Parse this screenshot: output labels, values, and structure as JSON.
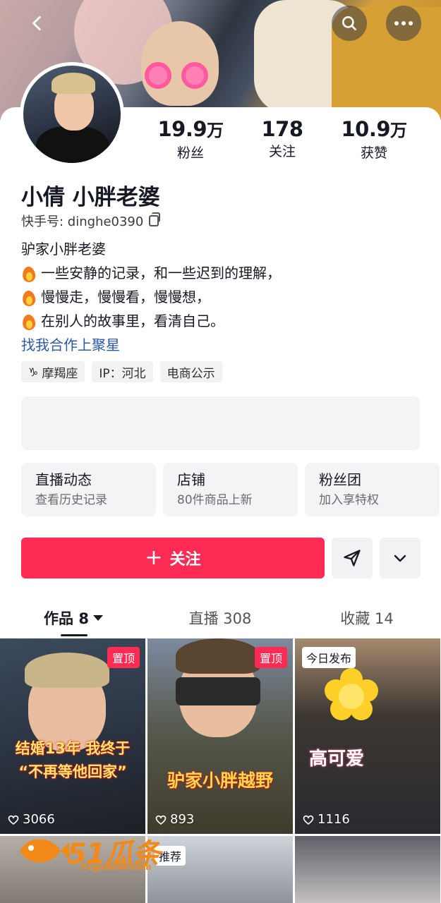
{
  "header": {
    "back_icon": "chevron-left-icon",
    "search_icon": "search-icon",
    "more_icon": "more-horizontal-icon"
  },
  "profile": {
    "stats": [
      {
        "num": "19.9",
        "unit": "万",
        "label": "粉丝"
      },
      {
        "num": "178",
        "unit": "",
        "label": "关注"
      },
      {
        "num": "10.9",
        "unit": "万",
        "label": "获赞"
      }
    ],
    "name": "小倩 小胖老婆",
    "uid_label": "快手号: dinghe0390",
    "bio": [
      "驴家小胖老婆",
      "一些安静的记录，和一些迟到的理解，",
      "慢慢走，慢慢看，慢慢想，",
      "在别人的故事里，看清自己。"
    ],
    "link": "找我合作上聚星",
    "tags": [
      "摩羯座",
      "IP：河北",
      "电商公示"
    ]
  },
  "features": [
    {
      "title": "直播动态",
      "sub": "查看历史记录"
    },
    {
      "title": "店铺",
      "sub": "80件商品上新"
    },
    {
      "title": "粉丝团",
      "sub": "加入享特权"
    }
  ],
  "actions": {
    "follow_label": "关注",
    "share_icon": "send-icon",
    "expand_icon": "chevron-down-icon"
  },
  "tabs": [
    {
      "label": "作品 8"
    },
    {
      "label": "直播 308"
    },
    {
      "label": "收藏 14"
    }
  ],
  "videos": [
    {
      "badge": "置顶",
      "likes": "3066",
      "caption": "结婚13年 我终于 “不再等他回家”"
    },
    {
      "badge": "置顶",
      "likes": "893",
      "caption": "驴家小胖越野"
    },
    {
      "badge": "今日发布",
      "likes": "1116",
      "caption": "高可爱"
    },
    {
      "badge": "",
      "likes": "",
      "caption": ""
    },
    {
      "badge": "推荐",
      "likes": "",
      "caption": ""
    },
    {
      "badge": "",
      "likes": "",
      "caption": ""
    }
  ],
  "watermark": {
    "text": "51瓜条",
    "url": "51guatiao.com"
  },
  "colors": {
    "accent": "#fe2c55",
    "link": "#2c59a8"
  }
}
